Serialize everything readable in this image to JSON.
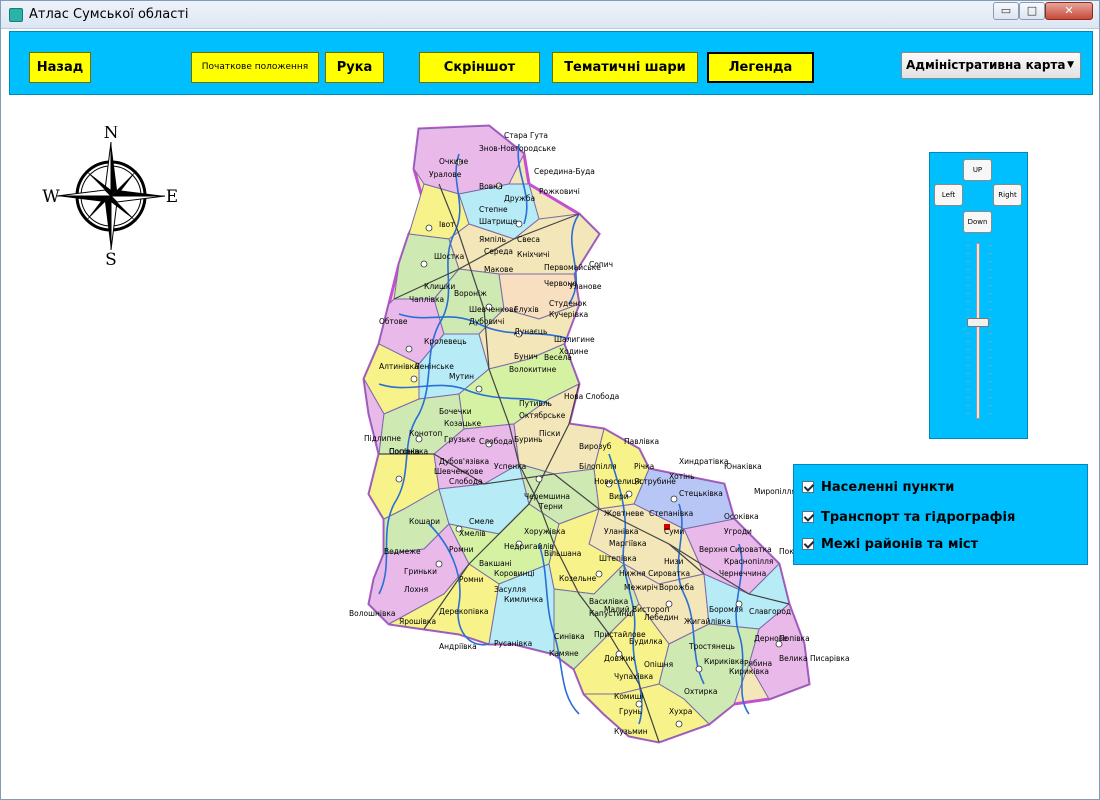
{
  "window": {
    "title": "Атлас Сумської області",
    "min_label": "▭",
    "max_label": "□",
    "close_label": "✕"
  },
  "toolbar": {
    "back": "Назад",
    "initial_position": "Початкове положення",
    "hand": "Рука",
    "screenshot": "Скріншот",
    "thematic_layers": "Тематичні шари",
    "legend": "Легенда",
    "map_select": {
      "value": "Адміністративна карта"
    }
  },
  "compass": {
    "north": "N",
    "south": "S",
    "west": "W",
    "east": "E"
  },
  "navigation": {
    "up": "UP",
    "left": "Left",
    "right": "Right",
    "down": "Down",
    "zoom_level": 0.55
  },
  "layers": [
    {
      "label": "Населенні пункти",
      "checked": true
    },
    {
      "label": "Транспорт та гідрографія",
      "checked": true
    },
    {
      "label": "Межі районів та міст",
      "checked": true
    }
  ],
  "map": {
    "cities": [
      "Стара Гута",
      "Знов-Новгородське",
      "Очкине",
      "Уралове",
      "Середина-Буда",
      "Вовна",
      "Дружба",
      "Рожковичі",
      "Степне",
      "Шатрище",
      "Івот",
      "Ямпіль",
      "Свеса",
      "Середа",
      "Шостка",
      "Макове",
      "Кніхчичі",
      "Первомайське",
      "Сопич",
      "Клишки",
      "Вороніж",
      "Червоне",
      "Уланове",
      "Чаплівка",
      "Шевченкове",
      "Глухів",
      "Студенок",
      "Кучерівка",
      "Обтове",
      "Дубовичі",
      "Дунаєць",
      "Шалигине",
      "Кролевець",
      "Бунич",
      "Весела",
      "Ходине",
      "Алтинівка",
      "Ленінське",
      "Мутин",
      "Волокитине",
      "Путивль",
      "Нова Слобода",
      "Бочечки",
      "Октябрське",
      "Конотоп",
      "Козацьке",
      "Підлипне",
      "Грузьке",
      "Слобода",
      "Буринь",
      "Піски",
      "Попівка",
      "Вирозуб",
      "Павлівка",
      "Сосонівка",
      "Дубов'язівка",
      "Хиндратівка",
      "Юнаківка",
      "Шевченкове",
      "Успенка",
      "Білопілля",
      "Річка",
      "Хотінь",
      "Новоселиця",
      "Слобода",
      "Яструбине",
      "Стецьківка",
      "Миропілля",
      "Кошари",
      "Черемшина",
      "Терни",
      "Вири",
      "Жовтневе",
      "Степанівка",
      "Осоківка",
      "Смеле",
      "Суми",
      "Угроди",
      "Хмелів",
      "Хоружівка",
      "Уланівка",
      "Маргіївка",
      "Ведмеже",
      "Ромни",
      "Верхня Сироватка",
      "Покровка",
      "Недригайлів",
      "Вільшана",
      "Штепівка",
      "Низи",
      "Краснопілля",
      "Вакшані",
      "Коровинці",
      "Нижня Сироватка",
      "Чернеччина",
      "Гриньки",
      "Ромни",
      "Козельне",
      "Межиріч",
      "Ворожба",
      "Лохня",
      "Засулля",
      "Василівка",
      "Малий Вистороп",
      "Боромля",
      "Славгород",
      "Волошнівка",
      "Ярошівка",
      "Дерекопівка",
      "Кимличка",
      "Капустинці",
      "Лебедин",
      "Жигайлівка",
      "Дернове",
      "Попівка",
      "Андріївка",
      "Русанівка",
      "Синівка",
      "Пристайлове",
      "Будилка",
      "Тростянець",
      "Велика Писарівка",
      "Камяне",
      "Довжик",
      "Опішня",
      "Кириківка",
      "Рябина",
      "Чупахівка",
      "Охтирка",
      "Грунь",
      "Комиші",
      "Хухра",
      "Кириківка",
      "Кузьмин"
    ]
  }
}
